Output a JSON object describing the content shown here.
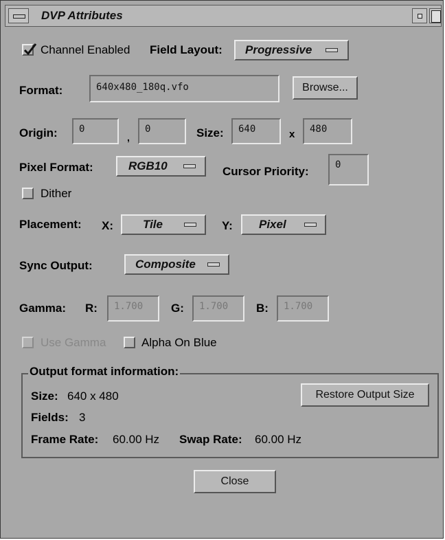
{
  "window": {
    "title": "DVP Attributes"
  },
  "channel": {
    "enabled_label": "Channel Enabled",
    "enabled": true
  },
  "field_layout": {
    "label": "Field Layout:",
    "value": "Progressive"
  },
  "format": {
    "label": "Format:",
    "value": "640x480_180q.vfo",
    "browse_label": "Browse..."
  },
  "origin": {
    "label": "Origin:",
    "x": "0",
    "sep": ",",
    "y": "0"
  },
  "size": {
    "label": "Size:",
    "w": "640",
    "sep": "x",
    "h": "480"
  },
  "pixel_format": {
    "label": "Pixel Format:",
    "value": "RGB10"
  },
  "cursor_priority": {
    "label": "Cursor Priority:",
    "value": "0"
  },
  "dither": {
    "label": "Dither",
    "checked": false
  },
  "placement": {
    "label": "Placement:",
    "x_label": "X:",
    "x_value": "Tile",
    "y_label": "Y:",
    "y_value": "Pixel"
  },
  "sync_output": {
    "label": "Sync Output:",
    "value": "Composite"
  },
  "gamma": {
    "label": "Gamma:",
    "r_label": "R:",
    "r": "1.700",
    "g_label": "G:",
    "g": "1.700",
    "b_label": "B:",
    "b": "1.700"
  },
  "use_gamma": {
    "label": "Use Gamma",
    "checked": false,
    "enabled": false
  },
  "alpha_on_blue": {
    "label": "Alpha On Blue",
    "checked": false
  },
  "output_info": {
    "title": "Output format information:",
    "size_label": "Size:",
    "size_value": "640 x 480",
    "restore_label": "Restore Output Size",
    "fields_label": "Fields:",
    "fields_value": "3",
    "frame_rate_label": "Frame Rate:",
    "frame_rate_value": "60.00 Hz",
    "swap_rate_label": "Swap Rate:",
    "swap_rate_value": "60.00 Hz"
  },
  "close_label": "Close",
  "colors": {
    "background": "#a8a8a8",
    "titlebar": "#b8b8b8"
  },
  "icons": [
    "window-menu-icon",
    "minimize-icon",
    "maximize-icon",
    "checkmark-icon",
    "option-menu-indicator-icon"
  ]
}
